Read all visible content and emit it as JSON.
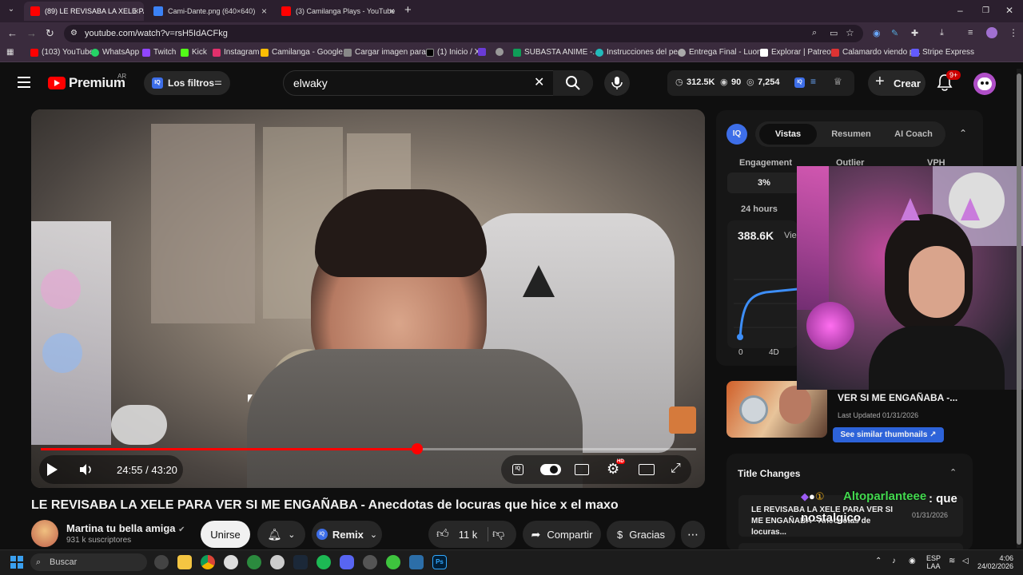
{
  "browser": {
    "tabs": [
      {
        "title": "(89) LE REVISABA LA XELE PARA",
        "color": "#ff0000"
      },
      {
        "title": "Cami-Dante.png (640×640)",
        "color": "#3b82f6"
      },
      {
        "title": "(3) Camilanga Plays - YouTube",
        "color": "#ff0000"
      }
    ],
    "url": "youtube.com/watch?v=rsH5IdACFkg",
    "bookmarks": [
      "(103) YouTube",
      "WhatsApp",
      "Twitch",
      "Kick",
      "Instagram",
      "Camilanga - Google...",
      "Cargar imagen para...",
      "(1) Inicio / X",
      "SUBASTA ANIME -...",
      "Instrucciones del pe...",
      "Entrega Final - Luon...",
      "Explorar | Patreon",
      "Calamardo viendo p...",
      "Stripe Express"
    ]
  },
  "header": {
    "logo": "Premium",
    "region": "AR",
    "filters_label": "Los filtros",
    "search_value": "elwaky",
    "stats": {
      "views": "312.5K",
      "watching": "90",
      "other": "7,254"
    },
    "create_label": "Crear",
    "notif_badge": "9+"
  },
  "video": {
    "time": "24:55 / 43:20",
    "progress": 0.575
  },
  "below": {
    "title": "LE REVISABA LA XELE PARA VER SI ME ENGAÑABA - Anecdotas de locuras que hice x el maxo",
    "channel": "Martina tu bella amiga",
    "subs": "931 k suscriptores",
    "join": "Unirse",
    "remix": "Remix",
    "likes": "11 k",
    "share": "Compartir",
    "thanks": "Gracias"
  },
  "panel": {
    "tabs": [
      "Vistas",
      "Resumen",
      "AI Coach"
    ],
    "metrics": [
      "Engagement",
      "Outlier",
      "VPH"
    ],
    "engagement_value": "3%",
    "period": "24 hours",
    "views_value": "388.6K",
    "views_suffix": "Vie",
    "axis": [
      "0",
      "4D"
    ],
    "thumb_title": "VER SI ME ENGAÑABA -...",
    "last_updated": "Last Updated 01/31/2026",
    "similar_btn": "See similar thumbnails ↗",
    "title_changes": "Title Changes",
    "change_title": "LE REVISABA LA XELE PARA VER SI ME ENGAÑABA - Anecdotas de locuras...",
    "change_date": "01/31/2026"
  },
  "chat": {
    "user": "Altoparlanteee",
    "message": ": que nostalgico"
  },
  "taskbar": {
    "search": "Buscar",
    "lang": "ESP",
    "lang2": "LAA",
    "time": "4:06",
    "date": "24/02/2026"
  }
}
